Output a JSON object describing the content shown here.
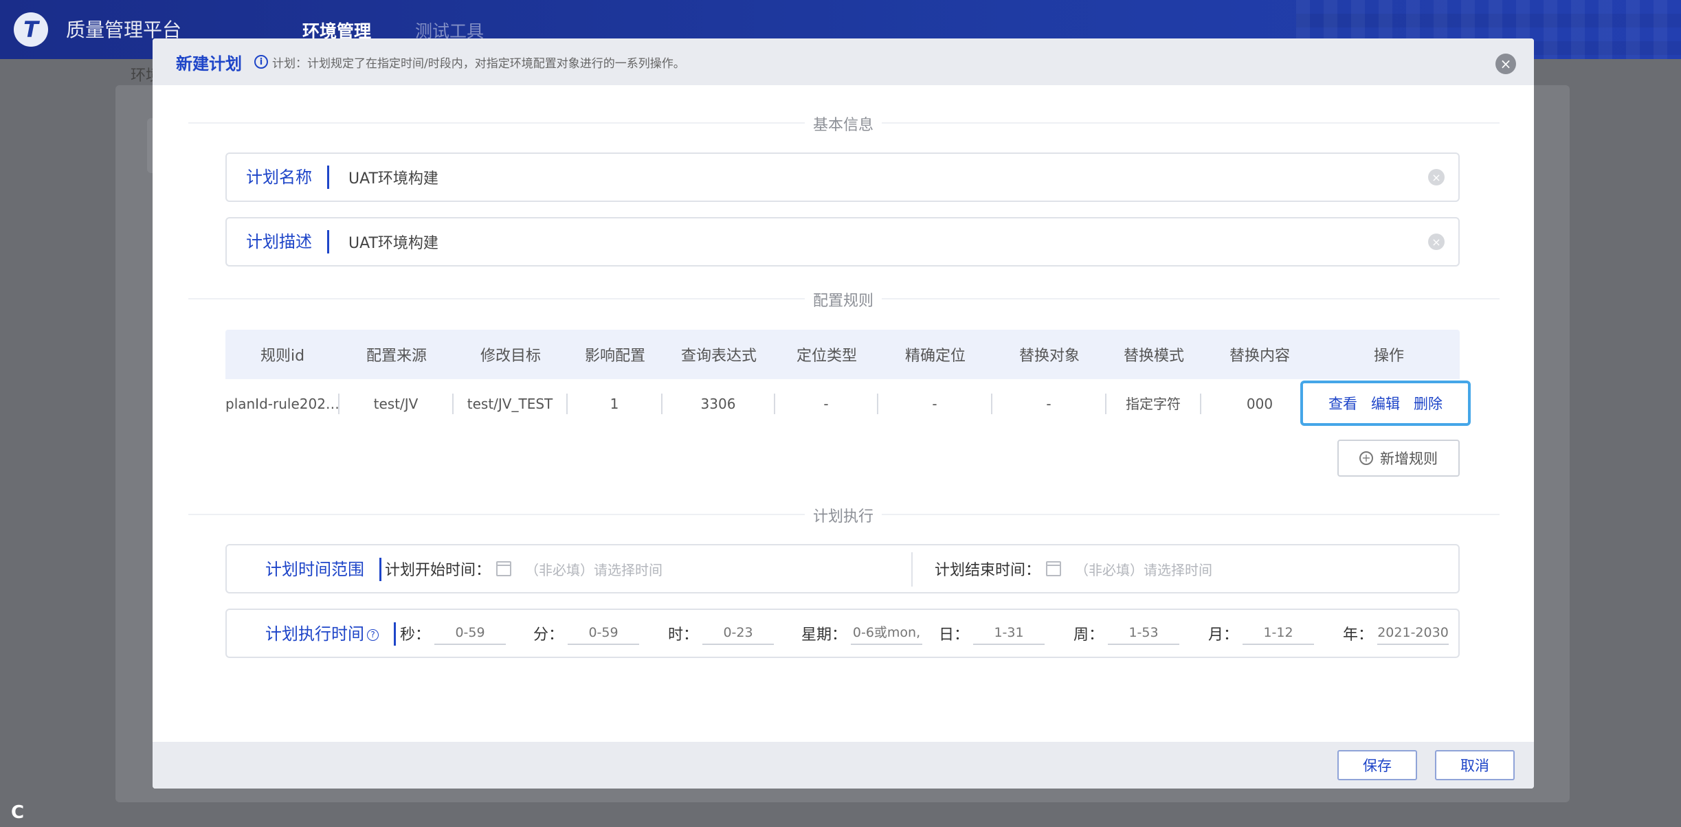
{
  "app": {
    "title": "质量管理平台",
    "logo_letter": "T",
    "nav": [
      "环境管理",
      "测试工具"
    ],
    "breadcrumb": "环境",
    "corner_letter": "C"
  },
  "modal": {
    "title": "新建计划",
    "hint": "计划：计划规定了在指定时间/时段内，对指定环境配置对象进行的一系列操作。",
    "close_symbol": "×",
    "sections": {
      "basic": "基本信息",
      "rules": "配置规则",
      "exec": "计划执行"
    },
    "plan_name": {
      "label": "计划名称",
      "value": "UAT环境构建"
    },
    "plan_desc": {
      "label": "计划描述",
      "value": "UAT环境构建"
    },
    "table": {
      "headers": [
        "规则id",
        "配置来源",
        "修改目标",
        "影响配置",
        "查询表达式",
        "定位类型",
        "精确定位",
        "替换对象",
        "替换模式",
        "替换内容",
        "操作"
      ],
      "rows": [
        {
          "id": "planId-rule202…",
          "source": "test/JV",
          "target": "test/JV_TEST",
          "affect": "1",
          "query": "3306",
          "loc_type": "-",
          "precise": "-",
          "replace_obj": "-",
          "mode": "指定字符",
          "content": "000"
        }
      ],
      "actions": {
        "view": "查看",
        "edit": "编辑",
        "delete": "删除"
      }
    },
    "add_rule": "新增规则",
    "time_range": {
      "label": "计划时间范围",
      "start_label": "计划开始时间：",
      "start_placeholder": "（非必填）请选择时间",
      "end_label": "计划结束时间：",
      "end_placeholder": "（非必填）请选择时间",
      "calendar_digit": "7"
    },
    "exec_time": {
      "label": "计划执行时间",
      "help_symbol": "?",
      "fields": [
        {
          "label": "秒：",
          "placeholder": "0-59"
        },
        {
          "label": "分：",
          "placeholder": "0-59"
        },
        {
          "label": "时：",
          "placeholder": "0-23"
        },
        {
          "label": "星期：",
          "placeholder": "0-6或mon,"
        },
        {
          "label": "日：",
          "placeholder": "1-31"
        },
        {
          "label": "周：",
          "placeholder": "1-53"
        },
        {
          "label": "月：",
          "placeholder": "1-12"
        },
        {
          "label": "年：",
          "placeholder": "2021-2030"
        }
      ]
    },
    "footer": {
      "save": "保存",
      "cancel": "取消"
    }
  },
  "colors": {
    "accent": "#1e45c8",
    "highlight": "#45a6e8",
    "header_bg": "#1f3ba3"
  }
}
